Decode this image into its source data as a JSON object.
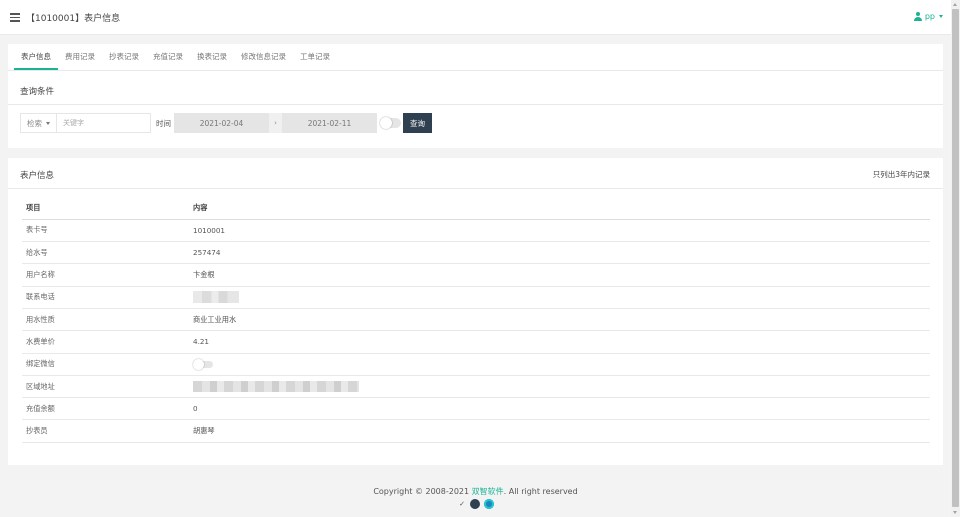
{
  "header": {
    "title": "【1010001】表户信息",
    "user_name": "pp"
  },
  "tabs": [
    {
      "label": "表户信息",
      "active": true
    },
    {
      "label": "费用记录"
    },
    {
      "label": "抄表记录"
    },
    {
      "label": "充值记录"
    },
    {
      "label": "换表记录"
    },
    {
      "label": "修改信息记录"
    },
    {
      "label": "工单记录"
    }
  ],
  "query": {
    "section_title": "查询条件",
    "select_label": "检索",
    "keyword_placeholder": "关键字",
    "time_label": "时间",
    "start_date": "2021-02-04",
    "date_separator": "›",
    "end_date": "2021-02-11",
    "toggle_on": false,
    "button_label": "查询"
  },
  "info": {
    "section_title": "表户信息",
    "note": "只列出3年内记录",
    "columns": [
      "项目",
      "内容"
    ],
    "rows": [
      {
        "item": "表卡号",
        "value": "1010001"
      },
      {
        "item": "给水号",
        "value": "257474"
      },
      {
        "item": "用户名称",
        "value": "卞金根"
      },
      {
        "item": "联系电话",
        "value": ""
      },
      {
        "item": "用水性质",
        "value": "商业工业用水"
      },
      {
        "item": "水费单价",
        "value": "4.21"
      },
      {
        "item": "绑定微信",
        "value": ""
      },
      {
        "item": "区域地址",
        "value": ""
      },
      {
        "item": "充值余额",
        "value": "0"
      },
      {
        "item": "抄表员",
        "value": "胡惠琴"
      }
    ],
    "wechat_bound": false
  },
  "footer": {
    "copyright_prefix": "Copyright © 2008-2021 ",
    "brand": "双智软件",
    "copyright_suffix": ". All right reserved",
    "check_mark": "✓",
    "theme_colors": [
      "#2f4050",
      "#1c84c6"
    ]
  },
  "colors": {
    "accent": "#1ab394",
    "dark": "#2f4050",
    "background": "#f3f3f4"
  }
}
